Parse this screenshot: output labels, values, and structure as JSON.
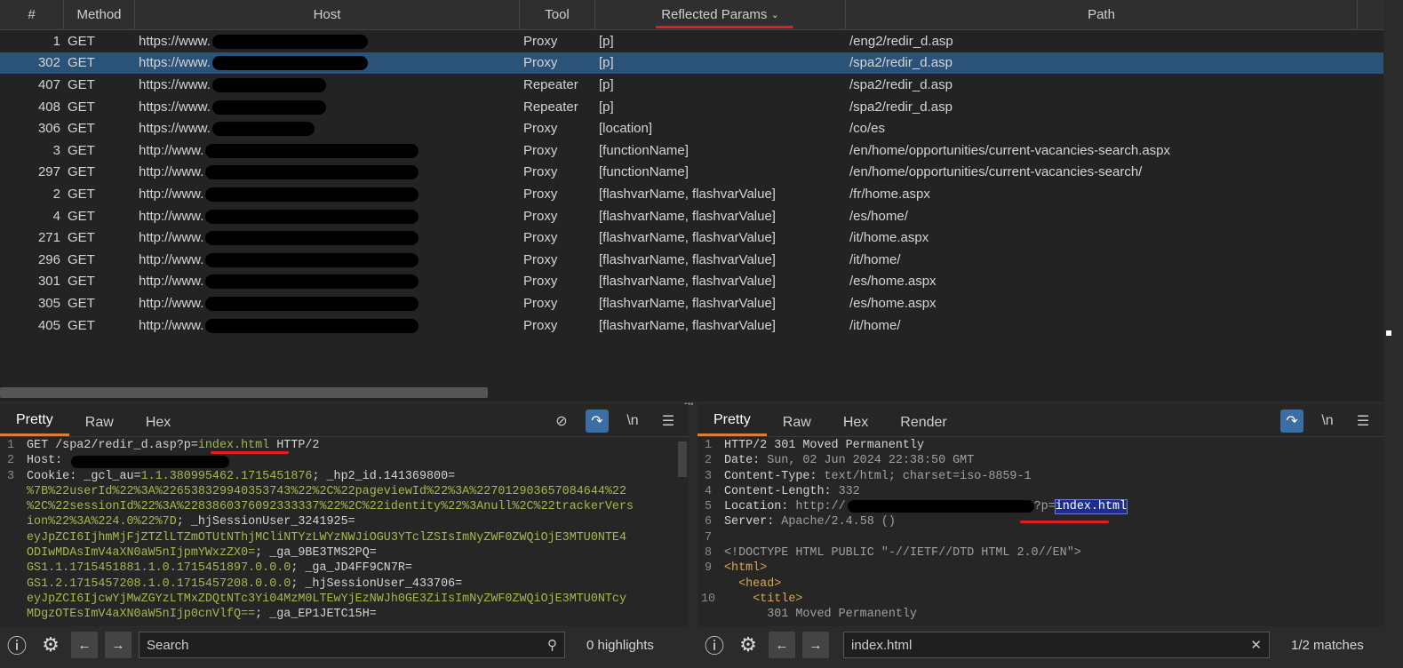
{
  "table": {
    "columns": [
      "#",
      "Method",
      "Host",
      "Tool",
      "Reflected Params",
      "Path"
    ],
    "sort_icon": "chevron-down-icon",
    "rows": [
      {
        "id": "1",
        "method": "GET",
        "host": "https://www.",
        "tool": "Proxy",
        "params": "[p]",
        "path": "/eng2/redir_d.asp"
      },
      {
        "id": "302",
        "method": "GET",
        "host": "https://www.",
        "tool": "Proxy",
        "params": "[p]",
        "path": "/spa2/redir_d.asp",
        "selected": true
      },
      {
        "id": "407",
        "method": "GET",
        "host": "https://www.",
        "tool": "Repeater",
        "params": "[p]",
        "path": "/spa2/redir_d.asp"
      },
      {
        "id": "408",
        "method": "GET",
        "host": "https://www.",
        "tool": "Repeater",
        "params": "[p]",
        "path": "/spa2/redir_d.asp"
      },
      {
        "id": "306",
        "method": "GET",
        "host": "https://www.",
        "tool": "Proxy",
        "params": "[location]",
        "path": "/co/es"
      },
      {
        "id": "3",
        "method": "GET",
        "host": "http://www.",
        "tool": "Proxy",
        "params": "[functionName]",
        "path": "/en/home/opportunities/current-vacancies-search.aspx"
      },
      {
        "id": "297",
        "method": "GET",
        "host": "http://www.",
        "tool": "Proxy",
        "params": "[functionName]",
        "path": "/en/home/opportunities/current-vacancies-search/"
      },
      {
        "id": "2",
        "method": "GET",
        "host": "http://www.",
        "tool": "Proxy",
        "params": "[flashvarName, flashvarValue]",
        "path": "/fr/home.aspx"
      },
      {
        "id": "4",
        "method": "GET",
        "host": "http://www.",
        "tool": "Proxy",
        "params": "[flashvarName, flashvarValue]",
        "path": "/es/home/"
      },
      {
        "id": "271",
        "method": "GET",
        "host": "http://www.",
        "tool": "Proxy",
        "params": "[flashvarName, flashvarValue]",
        "path": "/it/home.aspx"
      },
      {
        "id": "296",
        "method": "GET",
        "host": "http://www.",
        "tool": "Proxy",
        "params": "[flashvarName, flashvarValue]",
        "path": "/it/home/"
      },
      {
        "id": "301",
        "method": "GET",
        "host": "http://www.",
        "tool": "Proxy",
        "params": "[flashvarName, flashvarValue]",
        "path": "/es/home.aspx"
      },
      {
        "id": "305",
        "method": "GET",
        "host": "http://www.",
        "tool": "Proxy",
        "params": "[flashvarName, flashvarValue]",
        "path": "/es/home.aspx"
      },
      {
        "id": "405",
        "method": "GET",
        "host": "http://www.",
        "tool": "Proxy",
        "params": "[flashvarName, flashvarValue]",
        "path": "/it/home/"
      }
    ]
  },
  "request": {
    "tabs": [
      "Pretty",
      "Raw",
      "Hex"
    ],
    "active_tab": "Pretty",
    "lines": [
      [
        [
          "k",
          "GET /spa2/redir_d.asp?p="
        ],
        [
          "v",
          "index.html"
        ],
        [
          "k",
          " HTTP/2"
        ]
      ],
      [
        [
          "k",
          "Host: "
        ]
      ],
      [
        [
          "k",
          "Cookie: _gcl_au="
        ],
        [
          "v",
          "1.1.380995462.1715451876"
        ],
        [
          "k",
          "; _hp2_id.141369800="
        ]
      ],
      [
        [
          "v",
          "%7B%22userId%22%3A%226538329940353743%22%2C%22pageviewId%22%3A%227012903657084644%22"
        ]
      ],
      [
        [
          "v",
          "%2C%22sessionId%22%3A%2283860376092333337%22%2C%22identity%22%3Anull%2C%22trackerVers"
        ]
      ],
      [
        [
          "v",
          "ion%22%3A%224.0%22%7D"
        ],
        [
          "k",
          "; _hjSessionUser_3241925="
        ]
      ],
      [
        [
          "v",
          "eyJpZCI6IjhmMjFjZTZlLTZmOTUtNThjMCliNTYzLWYzNWJiOGU3YTclZSIsImNyZWF0ZWQiOjE3MTU0NTE4"
        ]
      ],
      [
        [
          "v",
          "ODIwMDAsImV4aXN0aW5nIjpmYWxzZX0="
        ],
        [
          "k",
          "; _ga_9BE3TMS2PQ="
        ]
      ],
      [
        [
          "v",
          "GS1.1.1715451881.1.0.1715451897.0.0.0"
        ],
        [
          "k",
          "; _ga_JD4FF9CN7R="
        ]
      ],
      [
        [
          "v",
          "GS1.2.1715457208.1.0.1715457208.0.0.0"
        ],
        [
          "k",
          "; _hjSessionUser_433706="
        ]
      ],
      [
        [
          "v",
          "eyJpZCI6IjcwYjMwZGYzLTMxZDQtNTc3Yi04MzM0LTEwYjEzNWJh0GE3ZiIsImNyZWF0ZWQiOjE3MTU0NTcy"
        ]
      ],
      [
        [
          "v",
          "MDgzOTEsImV4aXN0aW5nIjp0cnVlfQ=="
        ],
        [
          "k",
          "; _ga_EP1JETC15H="
        ]
      ]
    ],
    "gutter": [
      "1",
      "2",
      "3",
      "",
      "",
      "",
      "",
      "",
      "",
      "",
      "",
      ""
    ],
    "search_placeholder": "Search",
    "highlights": "0 highlights"
  },
  "response": {
    "tabs": [
      "Pretty",
      "Raw",
      "Hex",
      "Render"
    ],
    "active_tab": "Pretty",
    "lines": [
      [
        [
          "k",
          "HTTP/2 301 Moved Permanently"
        ]
      ],
      [
        [
          "k",
          "Date: "
        ],
        [
          "g",
          "Sun, 02 Jun 2024 22:38:50 GMT"
        ]
      ],
      [
        [
          "k",
          "Content-Type: "
        ],
        [
          "g",
          "text/html; charset=iso-8859-1"
        ]
      ],
      [
        [
          "k",
          "Content-Length: "
        ],
        [
          "g",
          "332"
        ]
      ],
      [
        [
          "k",
          "Location: "
        ],
        [
          "g",
          "http://"
        ]
      ],
      [
        [
          "k",
          "Server: "
        ],
        [
          "g",
          "Apache/2.4.58 ()"
        ]
      ],
      [
        [
          "k",
          ""
        ]
      ],
      [
        [
          "g",
          "<!DOCTYPE HTML PUBLIC \"-//IETF//DTD HTML 2.0//EN\">"
        ]
      ],
      [
        [
          "tag",
          "<html>"
        ]
      ],
      [
        [
          "tag",
          "  <head>"
        ]
      ],
      [
        [
          "tag",
          "    <title>"
        ]
      ],
      [
        [
          "g",
          "      301 Moved Permanently"
        ]
      ]
    ],
    "location_suffix": "?p=",
    "location_match": "index.html",
    "gutter": [
      "1",
      "2",
      "3",
      "4",
      "5",
      "6",
      "7",
      "8",
      "9",
      "",
      "10",
      ""
    ],
    "search_value": "index.html",
    "matches": "1/2 matches"
  }
}
